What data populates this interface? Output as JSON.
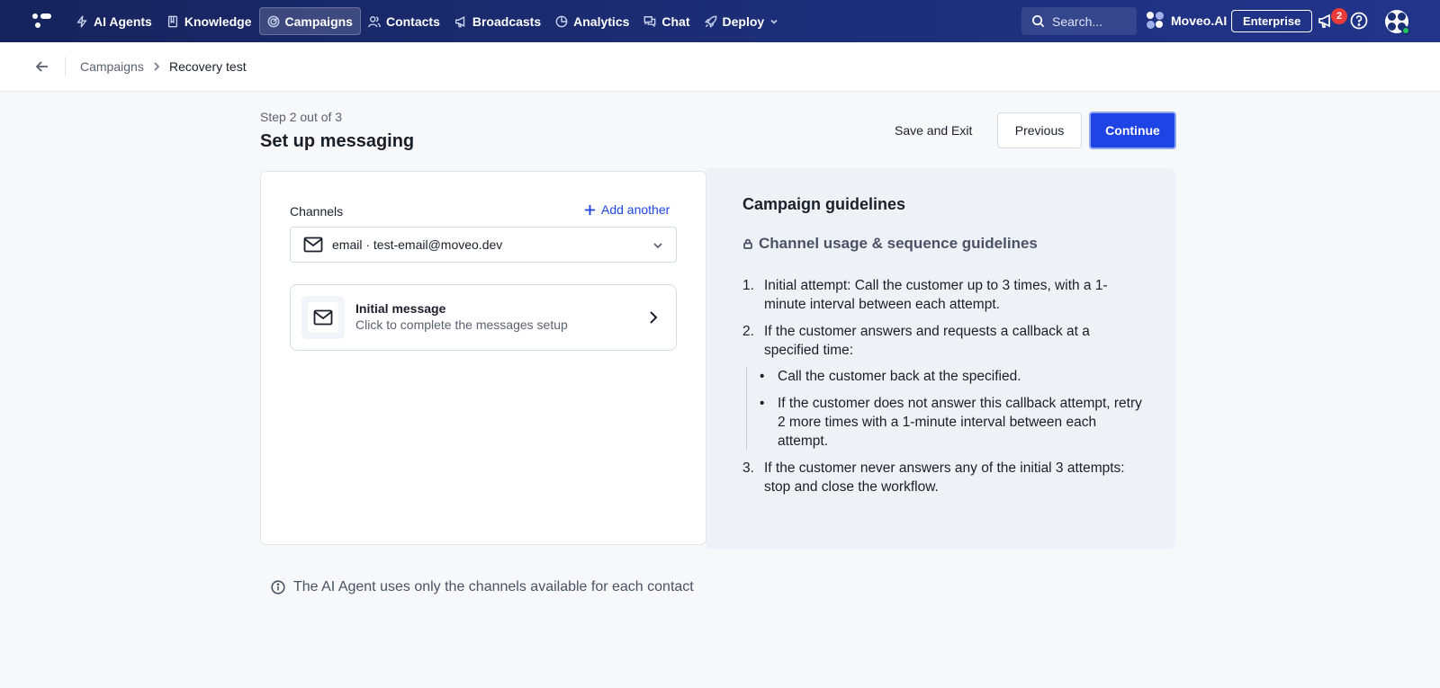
{
  "nav": {
    "items": [
      {
        "label": "AI Agents",
        "icon": "bolt-icon"
      },
      {
        "label": "Knowledge",
        "icon": "book-icon"
      },
      {
        "label": "Campaigns",
        "icon": "campaign-icon"
      },
      {
        "label": "Contacts",
        "icon": "users-icon"
      },
      {
        "label": "Broadcasts",
        "icon": "megaphone-icon"
      },
      {
        "label": "Analytics",
        "icon": "pie-chart-icon"
      },
      {
        "label": "Chat",
        "icon": "chat-icon"
      },
      {
        "label": "Deploy",
        "icon": "rocket-icon"
      }
    ],
    "active": "Campaigns",
    "search_placeholder": "Search...",
    "org_name": "Moveo.AI",
    "plan": "Enterprise",
    "notification_count": "2"
  },
  "breadcrumb": {
    "parent": "Campaigns",
    "current": "Recovery test"
  },
  "header": {
    "step": "Step 2 out of 3",
    "title": "Set up messaging",
    "save_exit": "Save and Exit",
    "previous": "Previous",
    "continue": "Continue"
  },
  "channels": {
    "label": "Channels",
    "add_another": "Add another",
    "selected": "email · test-email@moveo.dev",
    "message": {
      "title": "Initial message",
      "subtitle": "Click to complete the messages setup"
    }
  },
  "guidelines": {
    "title": "Campaign guidelines",
    "subtitle": "Channel usage & sequence guidelines",
    "steps": [
      "Initial attempt: Call the customer up to 3 times, with a 1-minute interval between each attempt.",
      "If the customer answers and requests a callback at a specified time:",
      "If the customer never answers any of the initial 3 attempts: stop and close the workflow."
    ],
    "sub_steps": [
      "Call the customer back at the specified.",
      "If the customer does not answer this callback attempt, retry 2 more times with a 1-minute interval between each attempt."
    ]
  },
  "footer_note": "The AI Agent uses only the channels available for each contact",
  "colors": {
    "nav_bg": "#1c2e78",
    "primary": "#1f44e6",
    "badge": "#ea3a3a",
    "panel_bg": "#eef1f6"
  }
}
